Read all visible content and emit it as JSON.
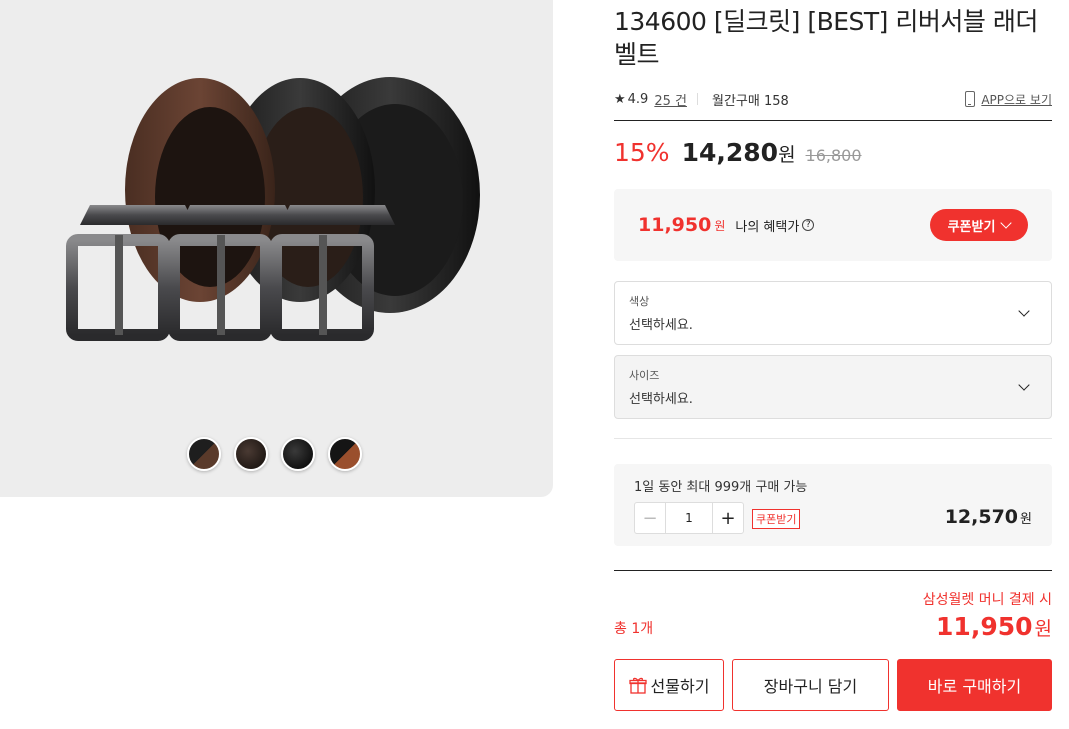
{
  "product": {
    "title": "134600 [딜크릿] [BEST] 리버서블 래더 벨트",
    "rating": "4.9",
    "review_count": "25 건",
    "monthly_sales": "월간구매 158",
    "app_link": "APP으로 보기"
  },
  "pricing": {
    "discount": "15%",
    "price": "14,280",
    "won": "원",
    "original_price": "16,800"
  },
  "benefit": {
    "price": "11,950",
    "won": "원",
    "label": "나의 혜택가",
    "help": "?",
    "coupon_button": "쿠폰받기"
  },
  "options": [
    {
      "label": "색상",
      "value": "선택하세요."
    },
    {
      "label": "사이즈",
      "value": "선택하세요."
    }
  ],
  "quantity": {
    "limit_text": "1일 동안 최대 999개 구매 가능",
    "minus": "−",
    "value": "1",
    "plus": "+",
    "coupon_label": "쿠폰받기",
    "item_price": "12,570",
    "won": "원"
  },
  "total": {
    "label": "총 1개",
    "payment_note": "삼성월렛 머니 결제 시",
    "price": "11,950",
    "won": "원"
  },
  "actions": {
    "gift": "선물하기",
    "cart": "장바구니 담기",
    "buy": "바로 구매하기"
  },
  "gallery": {
    "swatches": [
      "black-brown",
      "dark-brown",
      "black",
      "black-tan"
    ]
  },
  "colors": {
    "accent": "#f0322e",
    "text": "#222222"
  }
}
